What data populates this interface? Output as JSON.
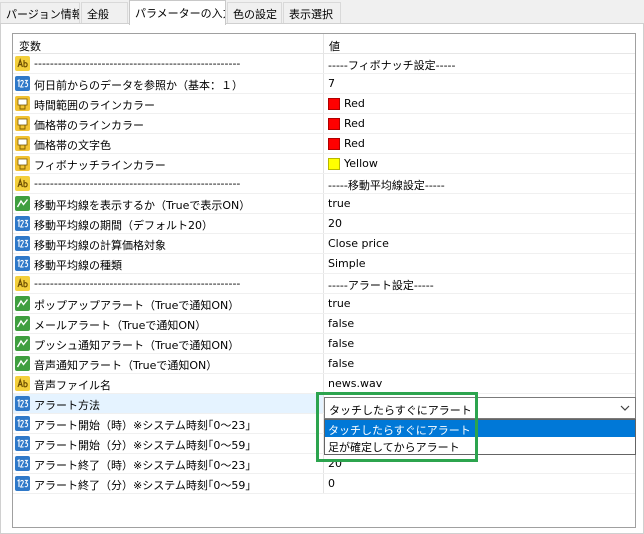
{
  "tabs": [
    {
      "label": "パージョン情報"
    },
    {
      "label": "全般"
    },
    {
      "label": "パラメーターの入力"
    },
    {
      "label": "色の設定"
    },
    {
      "label": "表示選択"
    }
  ],
  "header": {
    "name": "変数",
    "value": "値"
  },
  "rows": [
    {
      "name": "----------------------------------------------------",
      "value": "-----フィボナッチ設定-----",
      "icon": "ab"
    },
    {
      "name": "何日前からのデータを参照か（基本：１）",
      "value": "7",
      "icon": "123"
    },
    {
      "name": "時間範囲のラインカラー",
      "value": "Red",
      "icon": "color",
      "swatch": "#ff0000"
    },
    {
      "name": "価格帯のラインカラー",
      "value": "Red",
      "icon": "color",
      "swatch": "#ff0000"
    },
    {
      "name": "価格帯の文字色",
      "value": "Red",
      "icon": "color",
      "swatch": "#ff0000"
    },
    {
      "name": "フィボナッチラインカラー",
      "value": "Yellow",
      "icon": "color",
      "swatch": "#ffff00"
    },
    {
      "name": "----------------------------------------------------",
      "value": "-----移動平均線設定-----",
      "icon": "ab"
    },
    {
      "name": "移動平均線を表示するか（Trueで表示ON）",
      "value": "true",
      "icon": "bool"
    },
    {
      "name": "移動平均線の期間（デフォルト20）",
      "value": "20",
      "icon": "123"
    },
    {
      "name": "移動平均線の計算価格対象",
      "value": "Close price",
      "icon": "123"
    },
    {
      "name": "移動平均線の種類",
      "value": "Simple",
      "icon": "123"
    },
    {
      "name": "----------------------------------------------------",
      "value": "-----アラート設定-----",
      "icon": "ab"
    },
    {
      "name": "ポップアップアラート（Trueで通知ON）",
      "value": "true",
      "icon": "bool"
    },
    {
      "name": "メールアラート（Trueで通知ON）",
      "value": "false",
      "icon": "bool"
    },
    {
      "name": "プッシュ通知アラート（Trueで通知ON）",
      "value": "false",
      "icon": "bool"
    },
    {
      "name": "音声通知アラート（Trueで通知ON）",
      "value": "false",
      "icon": "bool"
    },
    {
      "name": "音声ファイル名",
      "value": "news.wav",
      "icon": "ab"
    },
    {
      "name": "アラート方法",
      "value": "",
      "icon": "123"
    },
    {
      "name": "アラート開始（時）※システム時刻｢0〜23｣",
      "value": "",
      "icon": "123"
    },
    {
      "name": "アラート開始（分）※システム時刻｢0〜59｣",
      "value": "",
      "icon": "123"
    },
    {
      "name": "アラート終了（時）※システム時刻｢0〜23｣",
      "value": "20",
      "icon": "123"
    },
    {
      "name": "アラート終了（分）※システム時刻｢0〜59｣",
      "value": "0",
      "icon": "123"
    }
  ],
  "combo": {
    "value": "タッチしたらすぐにアラート"
  },
  "dropdown": {
    "options": [
      "タッチしたらすぐにアラート",
      "足が確定してからアラート"
    ]
  },
  "colors": {
    "highlight": "#2ca44e",
    "selection": "#0078d7"
  }
}
